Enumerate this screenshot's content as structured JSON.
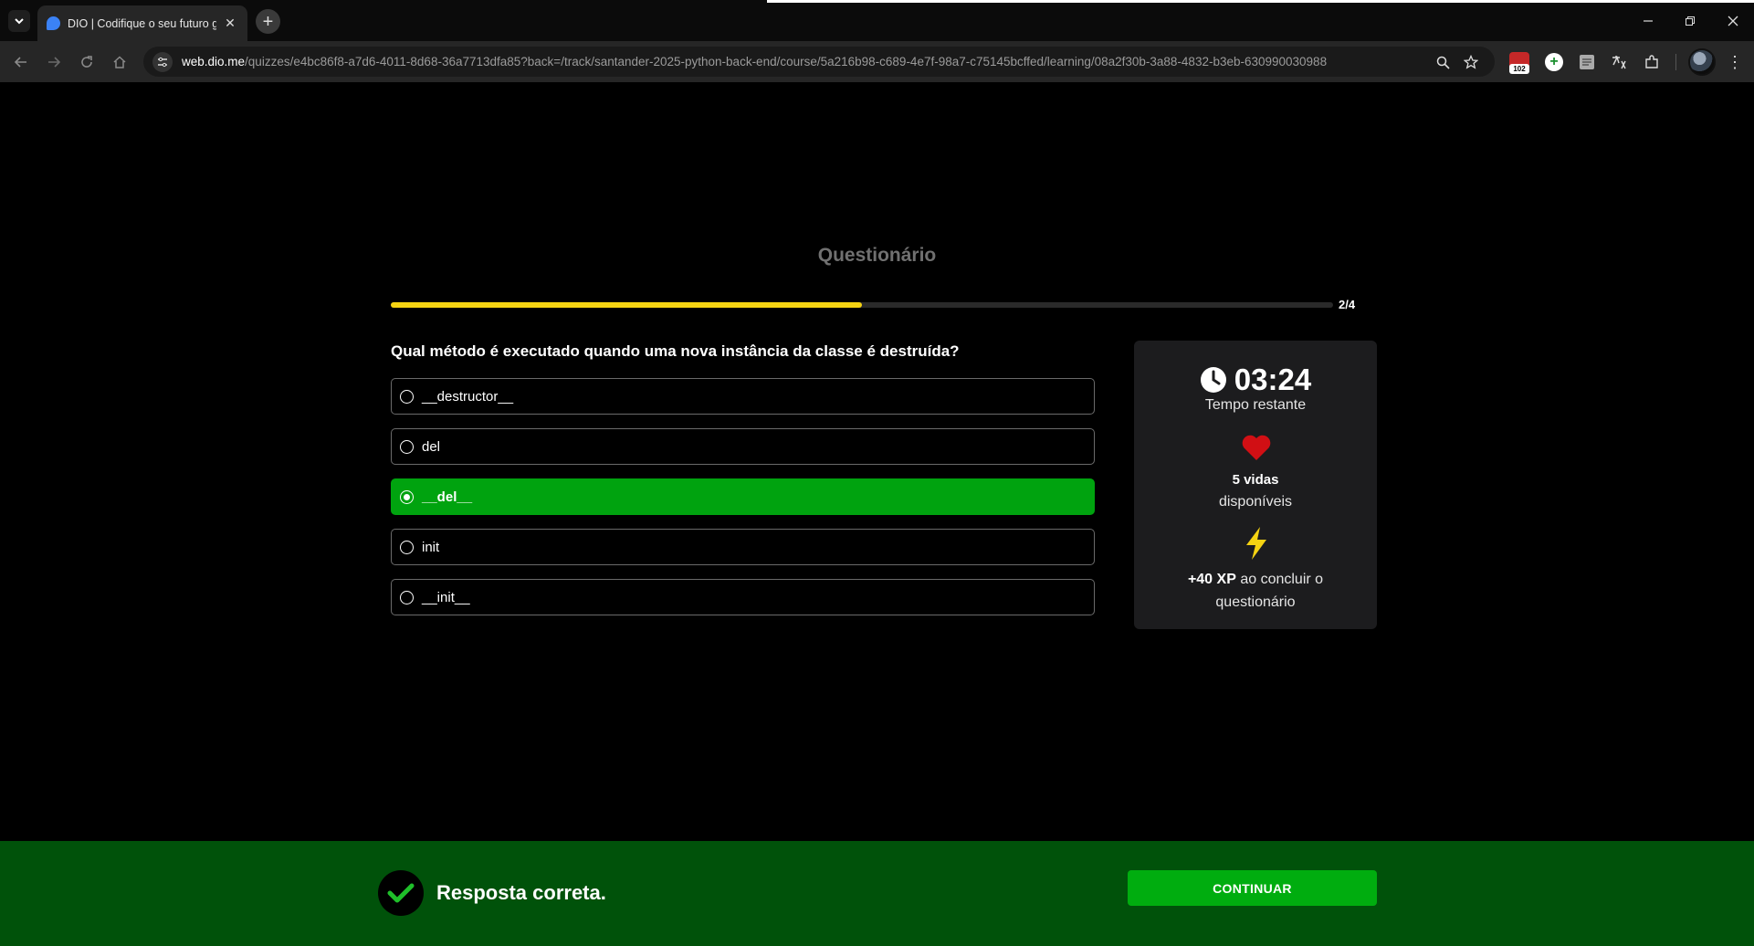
{
  "browser": {
    "tab_title": "DIO | Codifique o seu futuro gl",
    "tab_close": "✕",
    "new_tab": "+",
    "url_host": "web.dio.me",
    "url_path": "/quizzes/e4bc86f8-a7d6-4011-8d68-36a7713dfa85?back=/track/santander-2025-python-back-end/course/5a216b98-c689-4e7f-98a7-c75145bcffed/learning/08a2f30b-3a88-4832-b3eb-630990030988",
    "extension_badge_count": "102",
    "icons": [
      "tab-menu-icon",
      "back-icon",
      "forward-icon",
      "reload-icon",
      "home-icon",
      "site-info-icon",
      "zoom-icon",
      "bookmark-star-icon",
      "extensions-icon",
      "profile-icon",
      "menu-dots-icon"
    ]
  },
  "quiz": {
    "title": "Questionário",
    "progress_label": "2/4",
    "progress_fraction": 0.5,
    "question": "Qual método é executado quando uma nova instância da classe é destruída?",
    "options": [
      {
        "label": "__destructor__",
        "selected": false
      },
      {
        "label": "del",
        "selected": false
      },
      {
        "label": "__del__",
        "selected": true
      },
      {
        "label": "init",
        "selected": false
      },
      {
        "label": "__init__",
        "selected": false
      }
    ]
  },
  "info_card": {
    "timer": "03:24",
    "timer_label": "Tempo restante",
    "lives_count": "5 vidas",
    "lives_label": "disponíveis",
    "xp_bold": "+40 XP",
    "xp_text": " ao concluir o questionário"
  },
  "feedback": {
    "message": "Resposta correta.",
    "continue_label": "CONTINUAR"
  },
  "colors": {
    "accent_yellow": "#f5d312",
    "correct_green": "#00a30f",
    "feedback_bg": "#00520a",
    "heart_red": "#d10f14"
  }
}
